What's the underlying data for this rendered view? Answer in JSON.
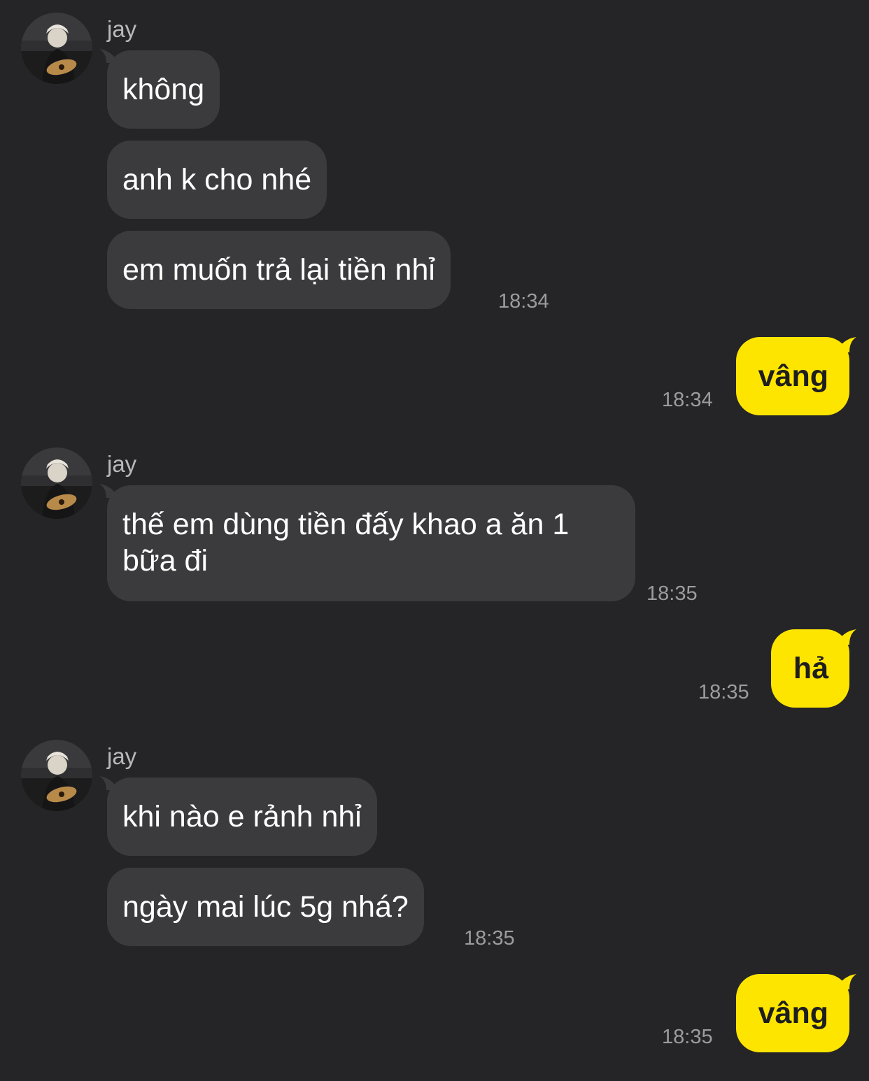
{
  "messages": {
    "group1": {
      "sender": "jay",
      "bubbles": [
        "không",
        "anh k cho nhé",
        "em muốn trả lại tiền nhỉ"
      ],
      "time": "18:34"
    },
    "reply1": {
      "text": "vâng",
      "time": "18:34"
    },
    "group2": {
      "sender": "jay",
      "bubbles": [
        "thế em dùng tiền đấy khao a ăn 1 bữa đi"
      ],
      "time": "18:35"
    },
    "reply2": {
      "text": "hả",
      "time": "18:35"
    },
    "group3": {
      "sender": "jay",
      "bubbles": [
        "khi nào e rảnh nhỉ",
        "ngày mai lúc 5g nhá?"
      ],
      "time": "18:35"
    },
    "reply3": {
      "text": "vâng",
      "time": "18:35"
    }
  },
  "colors": {
    "background": "#252527",
    "incoming_bubble": "#3b3b3d",
    "outgoing_bubble": "#fee500",
    "timestamp": "#9c9c9e"
  },
  "icons": {
    "avatar": "profile-photo-person-with-guitar"
  }
}
